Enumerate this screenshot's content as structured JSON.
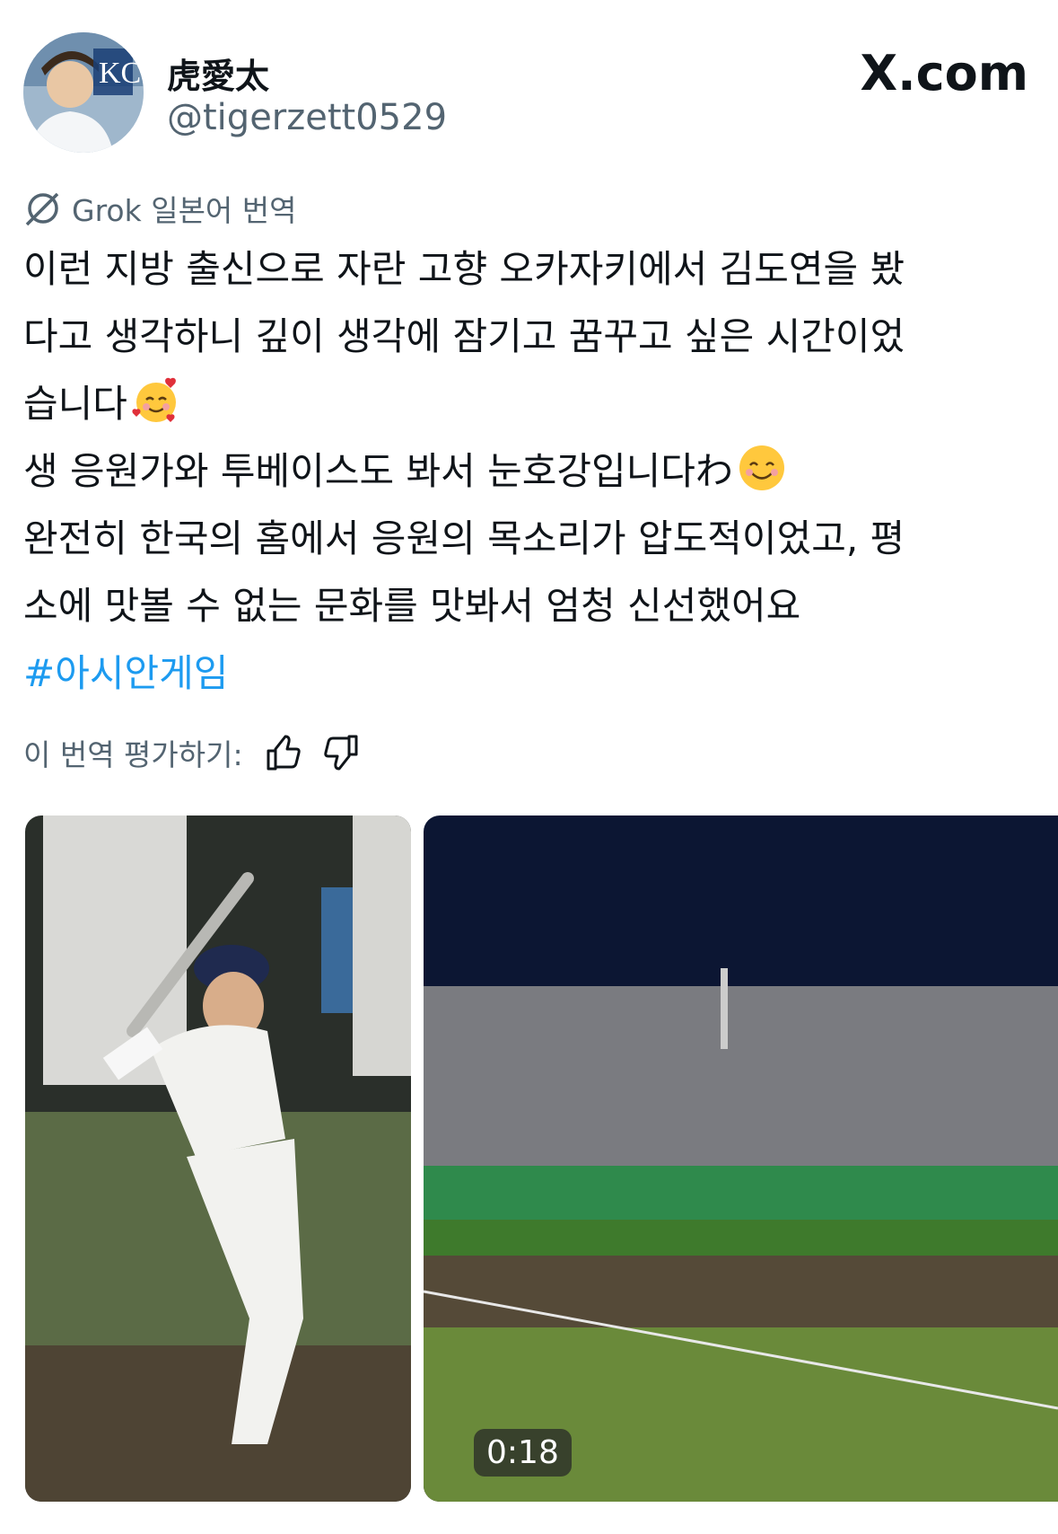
{
  "header": {
    "display_name": "虎愛太",
    "handle": "@tigerzett0529",
    "brand": "X.com",
    "avatar_icon": "profile-avatar"
  },
  "translation": {
    "icon": "grok-icon",
    "label": "Grok 일본어 번역"
  },
  "post": {
    "lines": [
      "이런 지방 출신으로 자란 고향 오카자키에서 김도연을 봤",
      "다고 생각하니 깊이 생각에 잠기고 꿈꾸고 싶은 시간이었",
      "습니다",
      "생 응원가와 투베이스도 봐서 눈호강입니다わ",
      "완전히 한국의 홈에서 응원의 목소리가 압도적이었고, 평",
      "소에 맛볼 수 없는 문화를 맛봐서 엄청 신선했어요"
    ],
    "emoji_1": "smiling-face-with-hearts",
    "emoji_2": "smiling-face",
    "hashtag": "#아시안게임"
  },
  "rating": {
    "label": "이 번역 평가하기:",
    "up_icon": "thumbs-up-icon",
    "down_icon": "thumbs-down-icon"
  },
  "media": {
    "video_duration": "0:18"
  },
  "colors": {
    "link": "#1d9bf0",
    "secondary_text": "#536471",
    "text": "#0f1419"
  }
}
